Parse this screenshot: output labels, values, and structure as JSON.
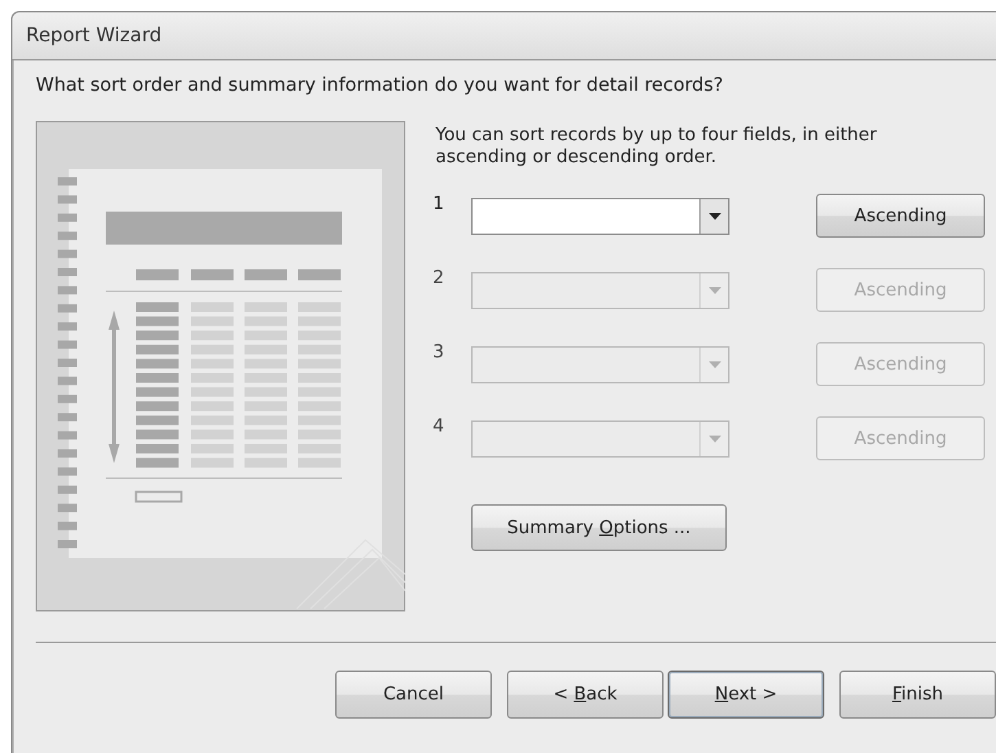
{
  "window": {
    "title": "Report Wizard"
  },
  "question": "What sort order and summary information do you want for detail records?",
  "instructions": "You can sort records by up to four fields, in either ascending or descending order.",
  "sort_rows": [
    {
      "number": "1",
      "value": "",
      "disabled": false,
      "order": "Ascending"
    },
    {
      "number": "2",
      "value": "",
      "disabled": true,
      "order": "Ascending"
    },
    {
      "number": "3",
      "value": "",
      "disabled": true,
      "order": "Ascending"
    },
    {
      "number": "4",
      "value": "",
      "disabled": true,
      "order": "Ascending"
    }
  ],
  "summary_button": {
    "label_before": "Summary ",
    "label_key": "O",
    "label_after": "ptions ..."
  },
  "buttons": [
    {
      "label_before": "Cancel",
      "default": false
    },
    {
      "label_before": "< ",
      "label_key": "B",
      "label_after": "ack",
      "default": false
    },
    {
      "label_key": "N",
      "label_after": "ext >",
      "default": true
    },
    {
      "label_key": "F",
      "label_after": "inish",
      "default": false
    }
  ]
}
